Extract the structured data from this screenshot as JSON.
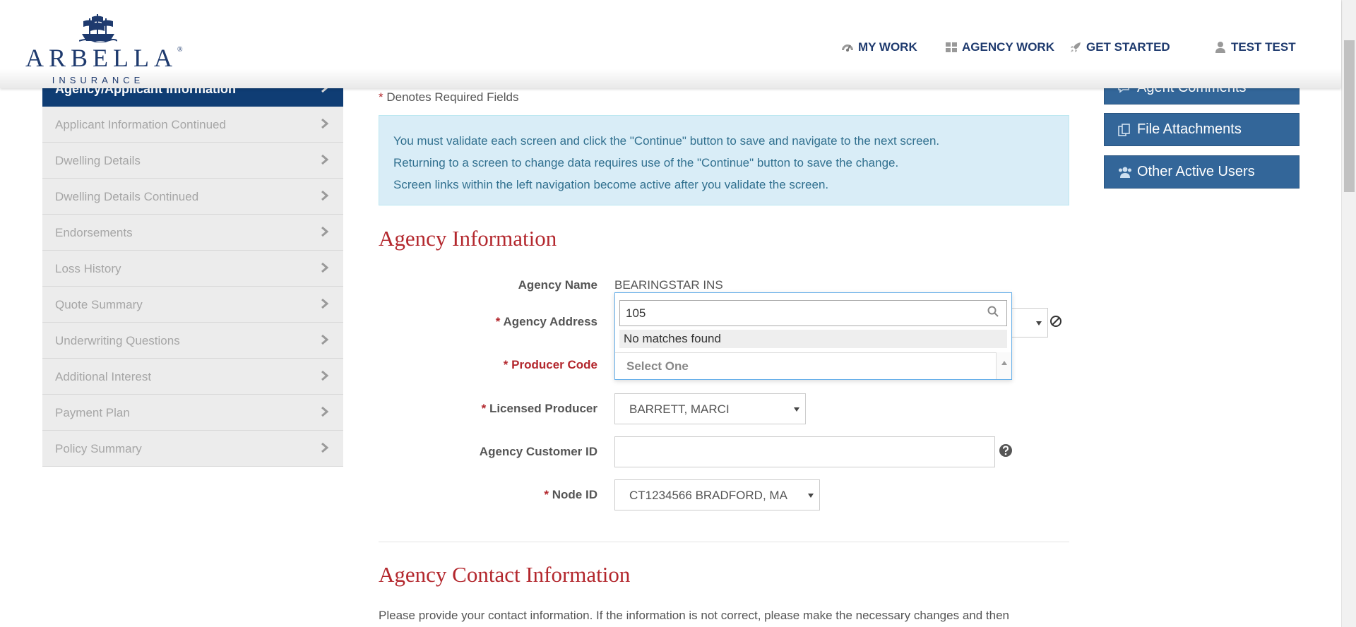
{
  "header": {
    "logo_text": "ARBELLA",
    "logo_sub": "INSURANCE",
    "logo_reg": "®",
    "nav": [
      {
        "label": "MY WORK",
        "icon": "dashboard-icon"
      },
      {
        "label": "AGENCY WORK",
        "icon": "grid-icon"
      },
      {
        "label": "GET STARTED",
        "icon": "rocket-icon"
      },
      {
        "label": "TEST TEST",
        "icon": "user-icon"
      }
    ]
  },
  "sidebar": {
    "active": "Agency/Applicant Information",
    "items": [
      "Applicant Information Continued",
      "Dwelling Details",
      "Dwelling Details Continued",
      "Endorsements",
      "Loss History",
      "Quote Summary",
      "Underwriting Questions",
      "Additional Interest",
      "Payment Plan",
      "Policy Summary"
    ]
  },
  "main": {
    "required_star": "*",
    "required_note": "Denotes Required Fields",
    "info_lines": [
      "You must validate each screen and click the \"Continue\" button to save and navigate to the next screen.",
      "Returning to a screen to change data requires use of the \"Continue\" button to save the change.",
      "Screen links within the left navigation become active after you validate the screen."
    ],
    "agency_section_title": "Agency Information",
    "fields": {
      "agency_name_label": "Agency Name",
      "agency_name_value": "BEARINGSTAR INS",
      "agency_address_label": "Agency Address",
      "producer_code_label": "Producer Code",
      "licensed_producer_label": "Licensed Producer",
      "licensed_producer_value": "BARRETT, MARCI",
      "agency_customer_id_label": "Agency Customer ID",
      "agency_customer_id_value": "",
      "node_id_label": "Node ID",
      "node_id_value": "CT1234566 BRADFORD, MA"
    },
    "dropdown": {
      "search_value": "105",
      "no_matches": "No matches found",
      "selected": "Select One"
    },
    "contact_section_title": "Agency Contact Information",
    "contact_paragraph": "Please provide your contact information. If the information is not correct, please make the necessary changes and then"
  },
  "right_panel": {
    "buttons": [
      {
        "label": "Agent Comments",
        "icon": "comments-icon"
      },
      {
        "label": "File Attachments",
        "icon": "file-attachments-icon"
      },
      {
        "label": "Other Active Users",
        "icon": "users-icon"
      }
    ]
  },
  "colors": {
    "brand_navy": "#1e3a6e",
    "sidebar_active": "#0f3d74",
    "accent_red": "#b3272d",
    "button_blue": "#336699",
    "info_bg": "#d9edf7"
  }
}
